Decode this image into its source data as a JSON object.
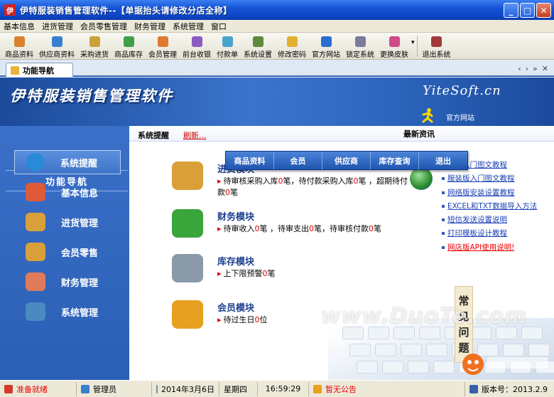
{
  "window": {
    "title": "伊特服装销售管理软件--【单据抬头请修改分店全称】",
    "logo": "伊"
  },
  "menu": [
    "基本信息",
    "进货管理",
    "会员零售管理",
    "财务管理",
    "系统管理",
    "窗口"
  ],
  "toolbar": [
    {
      "label": "商品资料",
      "icon": "product-icon",
      "color": "#d9822b"
    },
    {
      "label": "供应商资料",
      "icon": "supplier-icon",
      "color": "#3a7fd0"
    },
    {
      "label": "采购进货",
      "icon": "purchase-icon",
      "color": "#c9a23a"
    },
    {
      "label": "商品库存",
      "icon": "stock-icon",
      "color": "#3fa04a"
    },
    {
      "label": "会员管理",
      "icon": "member-icon",
      "color": "#e07a30"
    },
    {
      "label": "前台收银",
      "icon": "cashier-icon",
      "color": "#8a5cc0"
    },
    {
      "label": "付款单",
      "icon": "payment-icon",
      "color": "#4aa3c8"
    },
    {
      "label": "系统设置",
      "icon": "settings-icon",
      "color": "#5c8a3a"
    },
    {
      "label": "修改密码",
      "icon": "key-icon",
      "color": "#e0b030"
    },
    {
      "label": "官方网站",
      "icon": "ie-icon",
      "color": "#2a6fd0"
    },
    {
      "label": "锁定系统",
      "icon": "lock-icon",
      "color": "#7a7a9a"
    },
    {
      "label": "更换皮肤",
      "icon": "skin-icon",
      "color": "#d04a8a"
    },
    {
      "label": "退出系统",
      "icon": "exit-icon",
      "color": "#a03a3a"
    }
  ],
  "tab": {
    "label": "功能导航"
  },
  "banner": {
    "title": "伊特服装销售管理软件",
    "site": "YiteSoft.cn",
    "official": "官方网站"
  },
  "sidebar": {
    "heading": "功能导航",
    "items": [
      {
        "label": "系统提醒",
        "icon": "info-icon",
        "color": "#2a8ad8",
        "active": true
      },
      {
        "label": "基本信息",
        "icon": "cubes-icon",
        "color": "#e05a3a"
      },
      {
        "label": "进货管理",
        "icon": "box-check-icon",
        "color": "#d9a03a"
      },
      {
        "label": "会员零售",
        "icon": "box-member-icon",
        "color": "#d9a03a"
      },
      {
        "label": "财务管理",
        "icon": "house-icon",
        "color": "#e07a5a"
      },
      {
        "label": "系统管理",
        "icon": "monitor-icon",
        "color": "#4a8ac0"
      }
    ]
  },
  "main": {
    "alert_label": "系统提醒",
    "refresh": "刷新...",
    "news_label": "最新资讯",
    "quick": [
      "商品资料",
      "会员",
      "供应商",
      "库存查询",
      "退出"
    ],
    "modules": [
      {
        "title": "进货模块",
        "color": "#d9a03a",
        "parts": [
          "待审核采购入库",
          "0",
          "笔，待付款采购入库",
          "0",
          "笔 ，超期待付款",
          "0",
          "笔"
        ]
      },
      {
        "title": "财务模块",
        "color": "#3aa53a",
        "parts": [
          "待审收入",
          "0",
          "笔 ，待审支出",
          "0",
          "笔，待审核付款",
          "0",
          "笔"
        ]
      },
      {
        "title": "库存模块",
        "color": "#8a9aa8",
        "parts": [
          "上下限预警",
          "0",
          "笔"
        ]
      },
      {
        "title": "会员模块",
        "color": "#e8a020",
        "parts": [
          "待过生日",
          "0",
          "位"
        ]
      }
    ],
    "news": [
      {
        "text": "快速入门图文教程",
        "hot": false
      },
      {
        "text": "服装版入门图文教程",
        "hot": false
      },
      {
        "text": "网络版安装设置教程",
        "hot": false
      },
      {
        "text": "EXCEL和TXT数据导入方法",
        "hot": false
      },
      {
        "text": "短信发送设置说明",
        "hot": false
      },
      {
        "text": "打印模板设计教程",
        "hot": false
      },
      {
        "text": "网店版API使用说明!",
        "hot": true
      }
    ],
    "faq": [
      "常",
      "见",
      "问",
      "题"
    ],
    "watermark": "www.DuoTe.com"
  },
  "status": {
    "state": "准备就绪",
    "user": "管理员",
    "date": "2014年3月6日",
    "weekday": "星期四",
    "time": "16:59:29",
    "notice": "暂无公告",
    "version": "版本号：2013.2.9"
  }
}
